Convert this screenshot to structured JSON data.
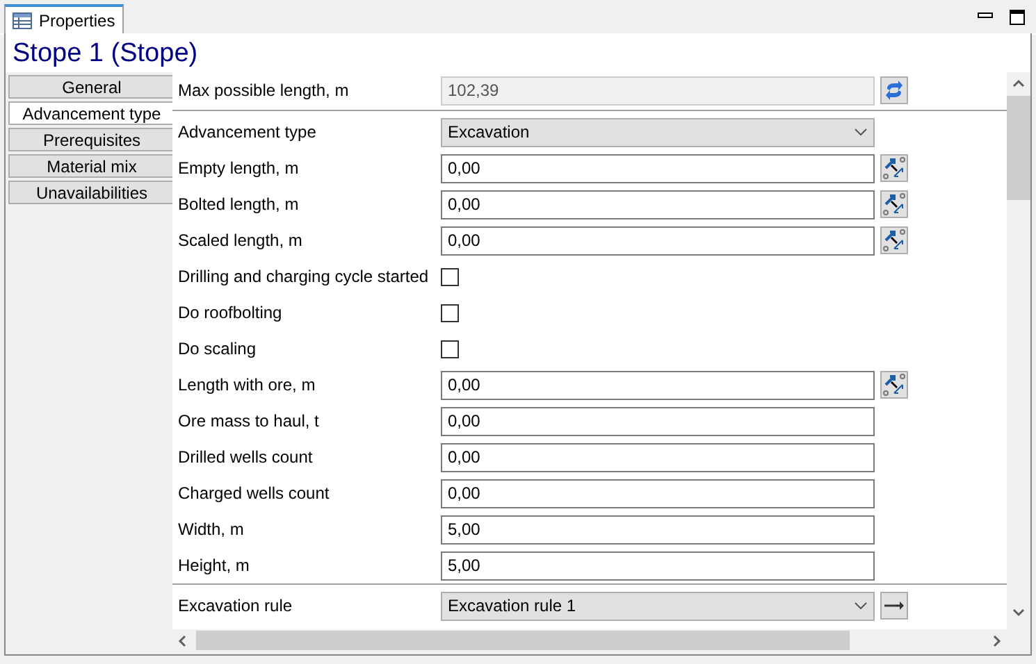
{
  "window": {
    "tab": "Properties"
  },
  "title": "Stope 1 (Stope)",
  "sidebar": {
    "items": [
      {
        "label": "General",
        "selected": false
      },
      {
        "label": "Advancement type",
        "selected": true
      },
      {
        "label": "Prerequisites",
        "selected": false
      },
      {
        "label": "Material mix",
        "selected": false
      },
      {
        "label": "Unavailabilities",
        "selected": false
      }
    ]
  },
  "sections": [
    {
      "rows": [
        {
          "label": "Max possible length, m",
          "kind": "readonly",
          "value": "102,39",
          "button": {
            "kind": "refresh"
          }
        }
      ]
    },
    {
      "rows": [
        {
          "label": "Advancement type",
          "kind": "select",
          "value": "Excavation"
        },
        {
          "label": "Empty length, m",
          "kind": "input",
          "value": "0,00",
          "button": {
            "kind": "measure"
          }
        },
        {
          "label": "Bolted length, m",
          "kind": "input",
          "value": "0,00",
          "button": {
            "kind": "measure"
          }
        },
        {
          "label": "Scaled length, m",
          "kind": "input",
          "value": "0,00",
          "button": {
            "kind": "measure"
          }
        },
        {
          "label": "Drilling and charging cycle started",
          "kind": "checkbox",
          "checked": false
        },
        {
          "label": "Do roofbolting",
          "kind": "checkbox",
          "checked": false
        },
        {
          "label": "Do scaling",
          "kind": "checkbox",
          "checked": false
        },
        {
          "label": "Length with ore, m",
          "kind": "input",
          "value": "0,00",
          "button": {
            "kind": "measure"
          }
        },
        {
          "label": "Ore mass to haul, t",
          "kind": "input",
          "value": "0,00"
        },
        {
          "label": "Drilled wells count",
          "kind": "input",
          "value": "0,00"
        },
        {
          "label": "Charged wells count",
          "kind": "input",
          "value": "0,00"
        },
        {
          "label": "Width, m",
          "kind": "input",
          "value": "5,00"
        },
        {
          "label": "Height, m",
          "kind": "input",
          "value": "5,00"
        }
      ]
    },
    {
      "rows": [
        {
          "label": "Excavation rule",
          "kind": "select",
          "value": "Excavation rule 1",
          "button": {
            "kind": "go"
          }
        }
      ]
    }
  ]
}
